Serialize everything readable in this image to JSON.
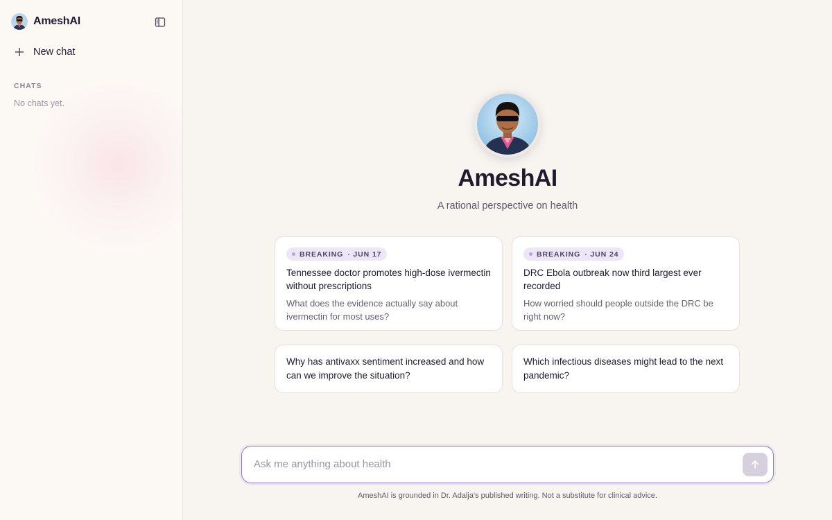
{
  "app": {
    "name": "AmeshAI"
  },
  "sidebar": {
    "brand_name": "AmeshAI",
    "toggle_icon": "sidebar-toggle-icon",
    "new_chat_label": "New chat",
    "chats_heading": "CHATS",
    "empty_state": "No chats yet."
  },
  "hero": {
    "title": "AmeshAI",
    "subtitle": "A rational perspective on health"
  },
  "cards": [
    {
      "badge": "BREAKING",
      "date": "· JUN 17",
      "title": "Tennessee doctor promotes high-dose ivermectin without prescriptions",
      "description": "What does the evidence actually say about ivermectin for most uses?"
    },
    {
      "badge": "BREAKING",
      "date": "· JUN 24",
      "title": "DRC Ebola outbreak now third largest ever recorded",
      "description": "How worried should people outside the DRC be right now?"
    },
    {
      "prompt": "Why has antivaxx sentiment increased and how can we improve the situation?"
    },
    {
      "prompt": "Which infectious diseases might lead to the next pandemic?"
    }
  ],
  "composer": {
    "placeholder": "Ask me anything about health",
    "value": "",
    "send_icon": "arrow-up-icon"
  },
  "footer": {
    "disclaimer": "AmeshAI is grounded in Dr. Adalja's published writing. Not a substitute for clinical advice."
  },
  "colors": {
    "accent": "#8f78d0",
    "badge_bg": "#ede6f6",
    "page_bg": "#f8f5f1",
    "sidebar_bg": "#fcf9f5"
  }
}
